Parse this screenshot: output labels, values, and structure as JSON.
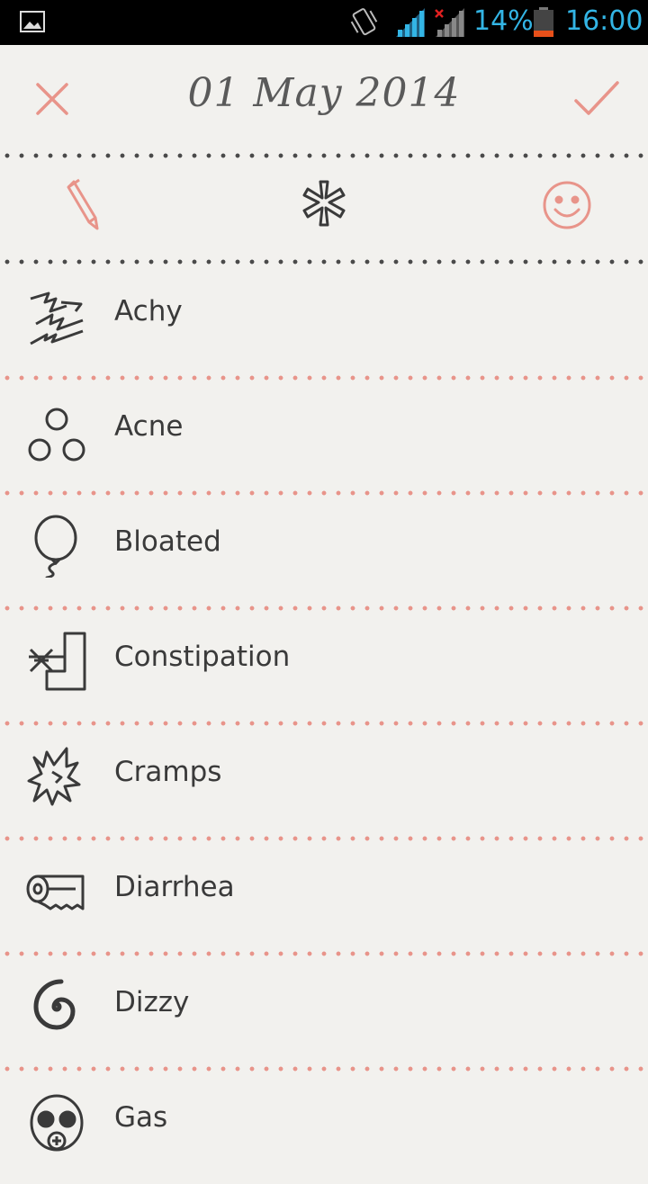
{
  "status_bar": {
    "battery_percent": "14%",
    "time": "16:00",
    "icons": [
      "gallery-icon",
      "vibrate-icon",
      "signal-icon",
      "signal-off-icon",
      "battery-icon"
    ],
    "colors": {
      "accent": "#33b5e5",
      "battery_low": "#e8501a"
    }
  },
  "header": {
    "date": "01 May 2014",
    "close_icon": "close-icon",
    "confirm_icon": "check-icon"
  },
  "tabs": [
    {
      "name": "notes",
      "icon": "pencil-icon"
    },
    {
      "name": "symptoms",
      "icon": "asterisk-icon",
      "selected": true
    },
    {
      "name": "moods",
      "icon": "smiley-icon"
    }
  ],
  "symptoms": [
    {
      "label": "Achy",
      "icon": "lightning-bolts-icon"
    },
    {
      "label": "Acne",
      "icon": "circles-icon"
    },
    {
      "label": "Bloated",
      "icon": "balloon-icon"
    },
    {
      "label": "Constipation",
      "icon": "blocked-toilet-icon"
    },
    {
      "label": "Cramps",
      "icon": "cramp-burst-icon"
    },
    {
      "label": "Diarrhea",
      "icon": "toilet-paper-icon"
    },
    {
      "label": "Dizzy",
      "icon": "spiral-icon"
    },
    {
      "label": "Gas",
      "icon": "gas-mask-icon"
    }
  ],
  "colors": {
    "accent": "#e8948a",
    "background": "#f2f1ee",
    "text": "#3a3a3a"
  }
}
